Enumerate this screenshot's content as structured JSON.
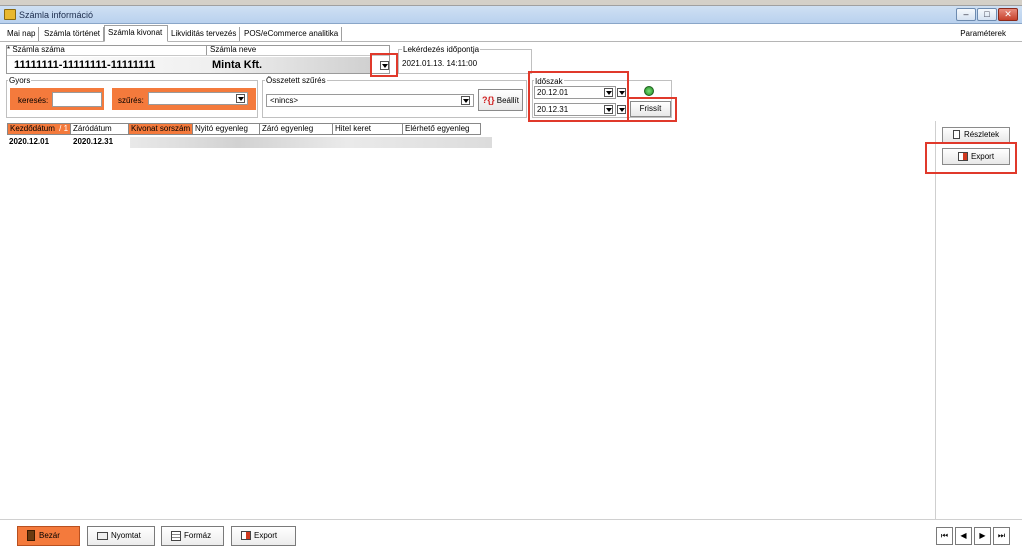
{
  "window": {
    "title": "Számla információ",
    "controls": [
      "–",
      "□",
      "✕"
    ]
  },
  "tabs": [
    {
      "label": "Mai nap"
    },
    {
      "label": "Számla történet"
    },
    {
      "label": "Számla kivonat"
    },
    {
      "label": "Likviditás tervezés"
    },
    {
      "label": "POS/eCommerce analitika"
    }
  ],
  "active_tab": "Számla kivonat",
  "parameters_label": "Paraméterek",
  "account": {
    "number_label": "* Számla száma",
    "number_value": "11111111-11111111-11111111",
    "name_label": "Számla neve",
    "name_value": "Minta Kft."
  },
  "query_time": {
    "label": "Lekérdezés időpontja",
    "value": "2021.01.13. 14:11:00"
  },
  "quick": {
    "group_label": "Gyors",
    "search_label": "keresés:",
    "search_value": "",
    "filter_label": "szűrés:",
    "filter_value": ""
  },
  "composite_filter": {
    "label": "Összetett szűrés",
    "value": "<nincs>",
    "setup_label": "Beállít",
    "setup_glyph": "?{}"
  },
  "period": {
    "label": "Időszak",
    "from": "20.12.01",
    "to": "20.12.31",
    "refresh_label": "Frissít"
  },
  "grid": {
    "columns": [
      {
        "label": "Kezdődátum"
      },
      {
        "label": "Záródátum"
      },
      {
        "label": "Kivonat sorszám"
      },
      {
        "label": "Nyitó egyenleg"
      },
      {
        "label": "Záró egyenleg"
      },
      {
        "label": "Hitel keret"
      },
      {
        "label": "Elérhető egyenleg"
      }
    ],
    "sort_indicator": "/ 1",
    "rows": [
      {
        "start": "2020.12.01",
        "end": "2020.12.31"
      }
    ]
  },
  "side_buttons": {
    "details": "Részletek",
    "export": "Export"
  },
  "bottom_buttons": {
    "close": "Bezár",
    "print": "Nyomtat",
    "format": "Formáz",
    "export": "Export"
  },
  "nav": {
    "first": "⏮",
    "prev": "◀",
    "next": "▶",
    "last": "⏭"
  },
  "colors": {
    "accent_orange": "#f47a3c",
    "highlight_red": "#e0392b",
    "title_bar": "#c3d7ef"
  }
}
